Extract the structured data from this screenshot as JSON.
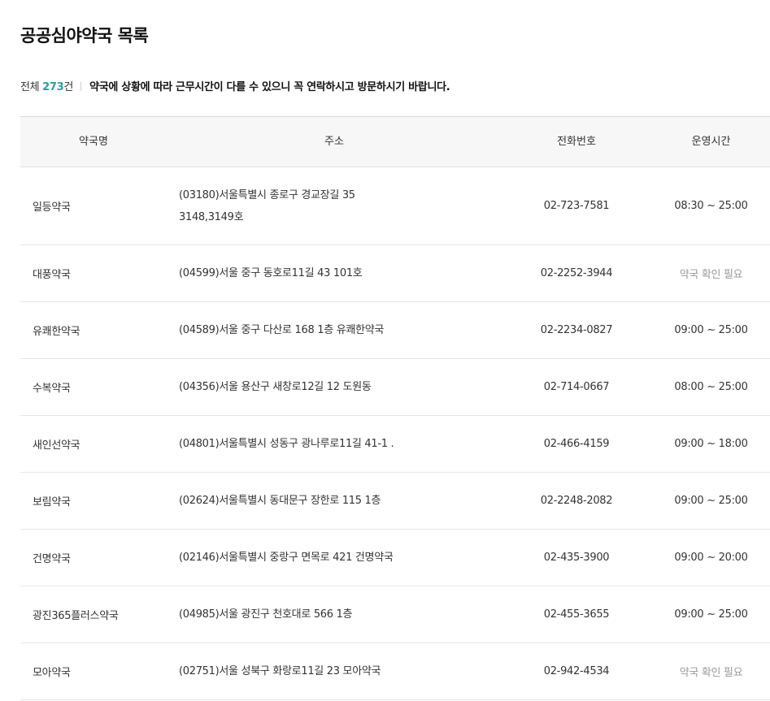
{
  "page": {
    "title": "공공심야약국 목록",
    "total_prefix": "전체 ",
    "total_count": "273",
    "total_suffix": "건",
    "notice": "약국에 상황에 따라 근무시간이 다를 수 있으니 꼭 연락하시고 방문하시기 바랍니다."
  },
  "table": {
    "headers": [
      "약국명",
      "주소",
      "전화번호",
      "운영시간"
    ],
    "rows": [
      {
        "name": "일등약국",
        "address": [
          "(03180)서울특별시 종로구 경교장길 35",
          "3148,3149호"
        ],
        "phone": "02-723-7581",
        "hours": "08:30 ~ 25:00"
      },
      {
        "name": "대풍약국",
        "address": [
          "(04599)서울 중구 동호로11길 43 101호"
        ],
        "phone": "02-2252-3944",
        "hours": "약국 확인 필요"
      },
      {
        "name": "유쾌한약국",
        "address": [
          "(04589)서울 중구 다산로 168 1층 유쾌한약국"
        ],
        "phone": "02-2234-0827",
        "hours": "09:00 ~ 25:00"
      },
      {
        "name": "수복약국",
        "address": [
          "(04356)서울 용산구 새창로12길 12 도원동"
        ],
        "phone": "02-714-0667",
        "hours": "08:00 ~ 25:00"
      },
      {
        "name": "새인선약국",
        "address": [
          "(04801)서울특별시 성동구 광나루로11길 41-1 ."
        ],
        "phone": "02-466-4159",
        "hours": "09:00 ~ 18:00"
      },
      {
        "name": "보림약국",
        "address": [
          "(02624)서울특별시 동대문구 장한로 115 1층"
        ],
        "phone": "02-2248-2082",
        "hours": "09:00 ~ 25:00"
      },
      {
        "name": "건명약국",
        "address": [
          "(02146)서울특별시 중랑구 면목로 421 건명약국"
        ],
        "phone": "02-435-3900",
        "hours": "09:00 ~ 20:00"
      },
      {
        "name": "광진365플러스약국",
        "address": [
          "(04985)서울 광진구 천호대로 566 1층"
        ],
        "phone": "02-455-3655",
        "hours": "09:00 ~ 25:00"
      },
      {
        "name": "모아약국",
        "address": [
          "(02751)서울 성북구 화랑로11길 23 모아약국"
        ],
        "phone": "02-942-4534",
        "hours": "약국 확인 필요"
      }
    ]
  },
  "colors": {
    "accent": "#2a9d9a",
    "header_bg": "#f7f7f7",
    "muted_text": "#999999"
  }
}
